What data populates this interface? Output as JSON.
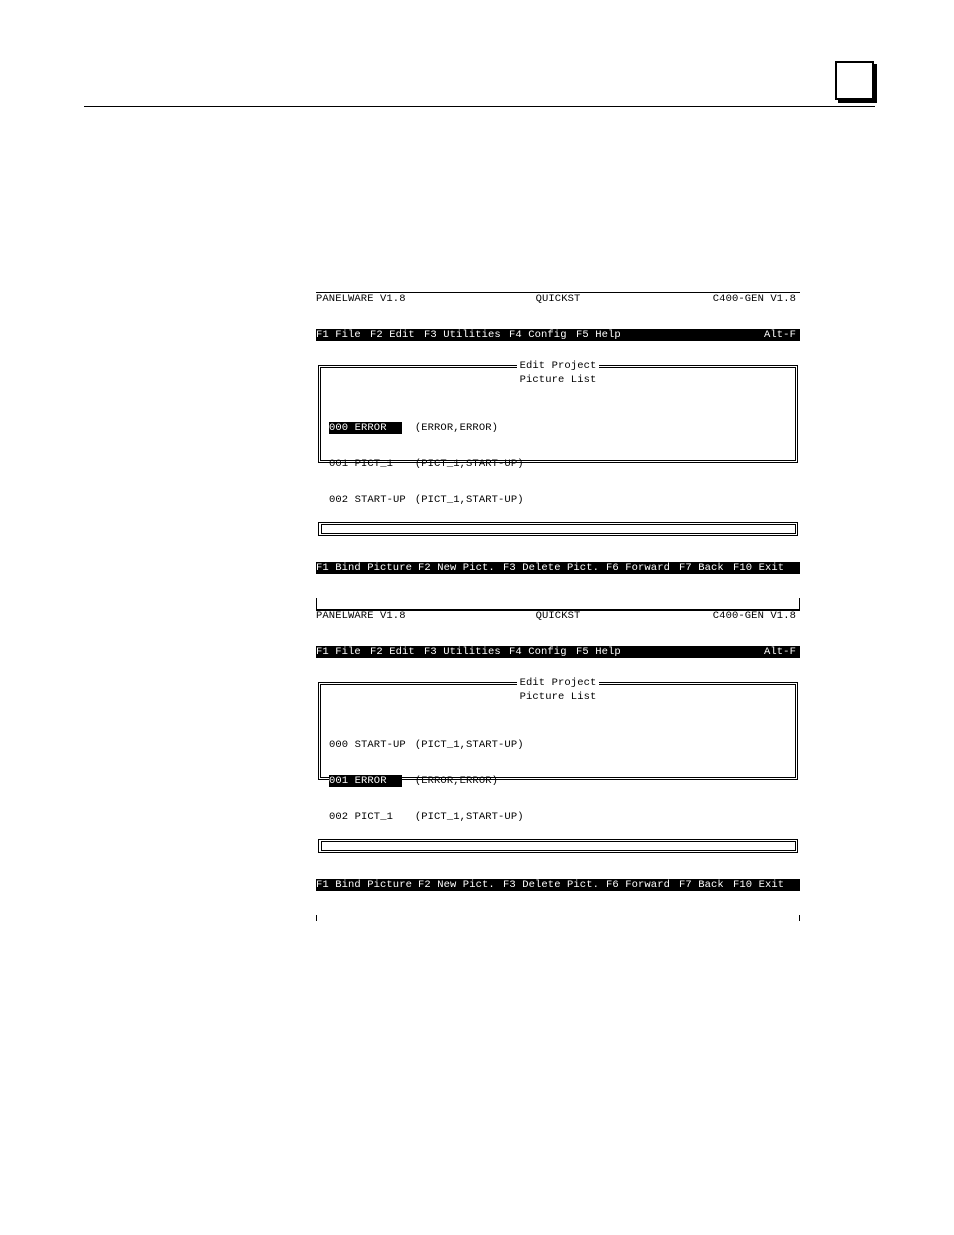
{
  "screens": [
    {
      "header": {
        "app": "PANELWARE V1.8",
        "project": "QUICKST",
        "version": "C400-GEN V1.8"
      },
      "menu": {
        "file": "F1 File",
        "edit": "F2 Edit",
        "utilities": "F3 Utilities",
        "config": "F4 Config",
        "help": "F5 Help",
        "alt": "Alt-F"
      },
      "frame_title": "Edit Project",
      "subtitle": "Picture List",
      "items": [
        {
          "name": "000 ERROR",
          "detail": "(ERROR,ERROR)"
        },
        {
          "name": "001 PICT_1",
          "detail": "(PICT_1,START-UP)"
        },
        {
          "name": "002 START-UP",
          "detail": "(PICT_1,START-UP)"
        }
      ],
      "fkeys": {
        "bind": "F1 Bind Picture",
        "new": "F2 New Pict.",
        "delete": "F3 Delete Pict.",
        "forward": "F6 Forward",
        "back": "F7 Back",
        "exit": "F10 Exit"
      }
    },
    {
      "header": {
        "app": "PANELWARE V1.8",
        "project": "QUICKST",
        "version": "C400-GEN V1.8"
      },
      "menu": {
        "file": "F1 File",
        "edit": "F2 Edit",
        "utilities": "F3 Utilities",
        "config": "F4 Config",
        "help": "F5 Help",
        "alt": "Alt-F"
      },
      "frame_title": "Edit Project",
      "subtitle": "Picture List",
      "items": [
        {
          "name": "000 START-UP",
          "detail": "(PICT_1,START-UP)"
        },
        {
          "name": "001 ERROR",
          "detail": "(ERROR,ERROR)"
        },
        {
          "name": "002 PICT_1",
          "detail": "(PICT_1,START-UP)"
        }
      ],
      "fkeys": {
        "bind": "F1 Bind Picture",
        "new": "F2 New Pict.",
        "delete": "F3 Delete Pict.",
        "forward": "F6 Forward",
        "back": "F7 Back",
        "exit": "F10 Exit"
      }
    }
  ]
}
